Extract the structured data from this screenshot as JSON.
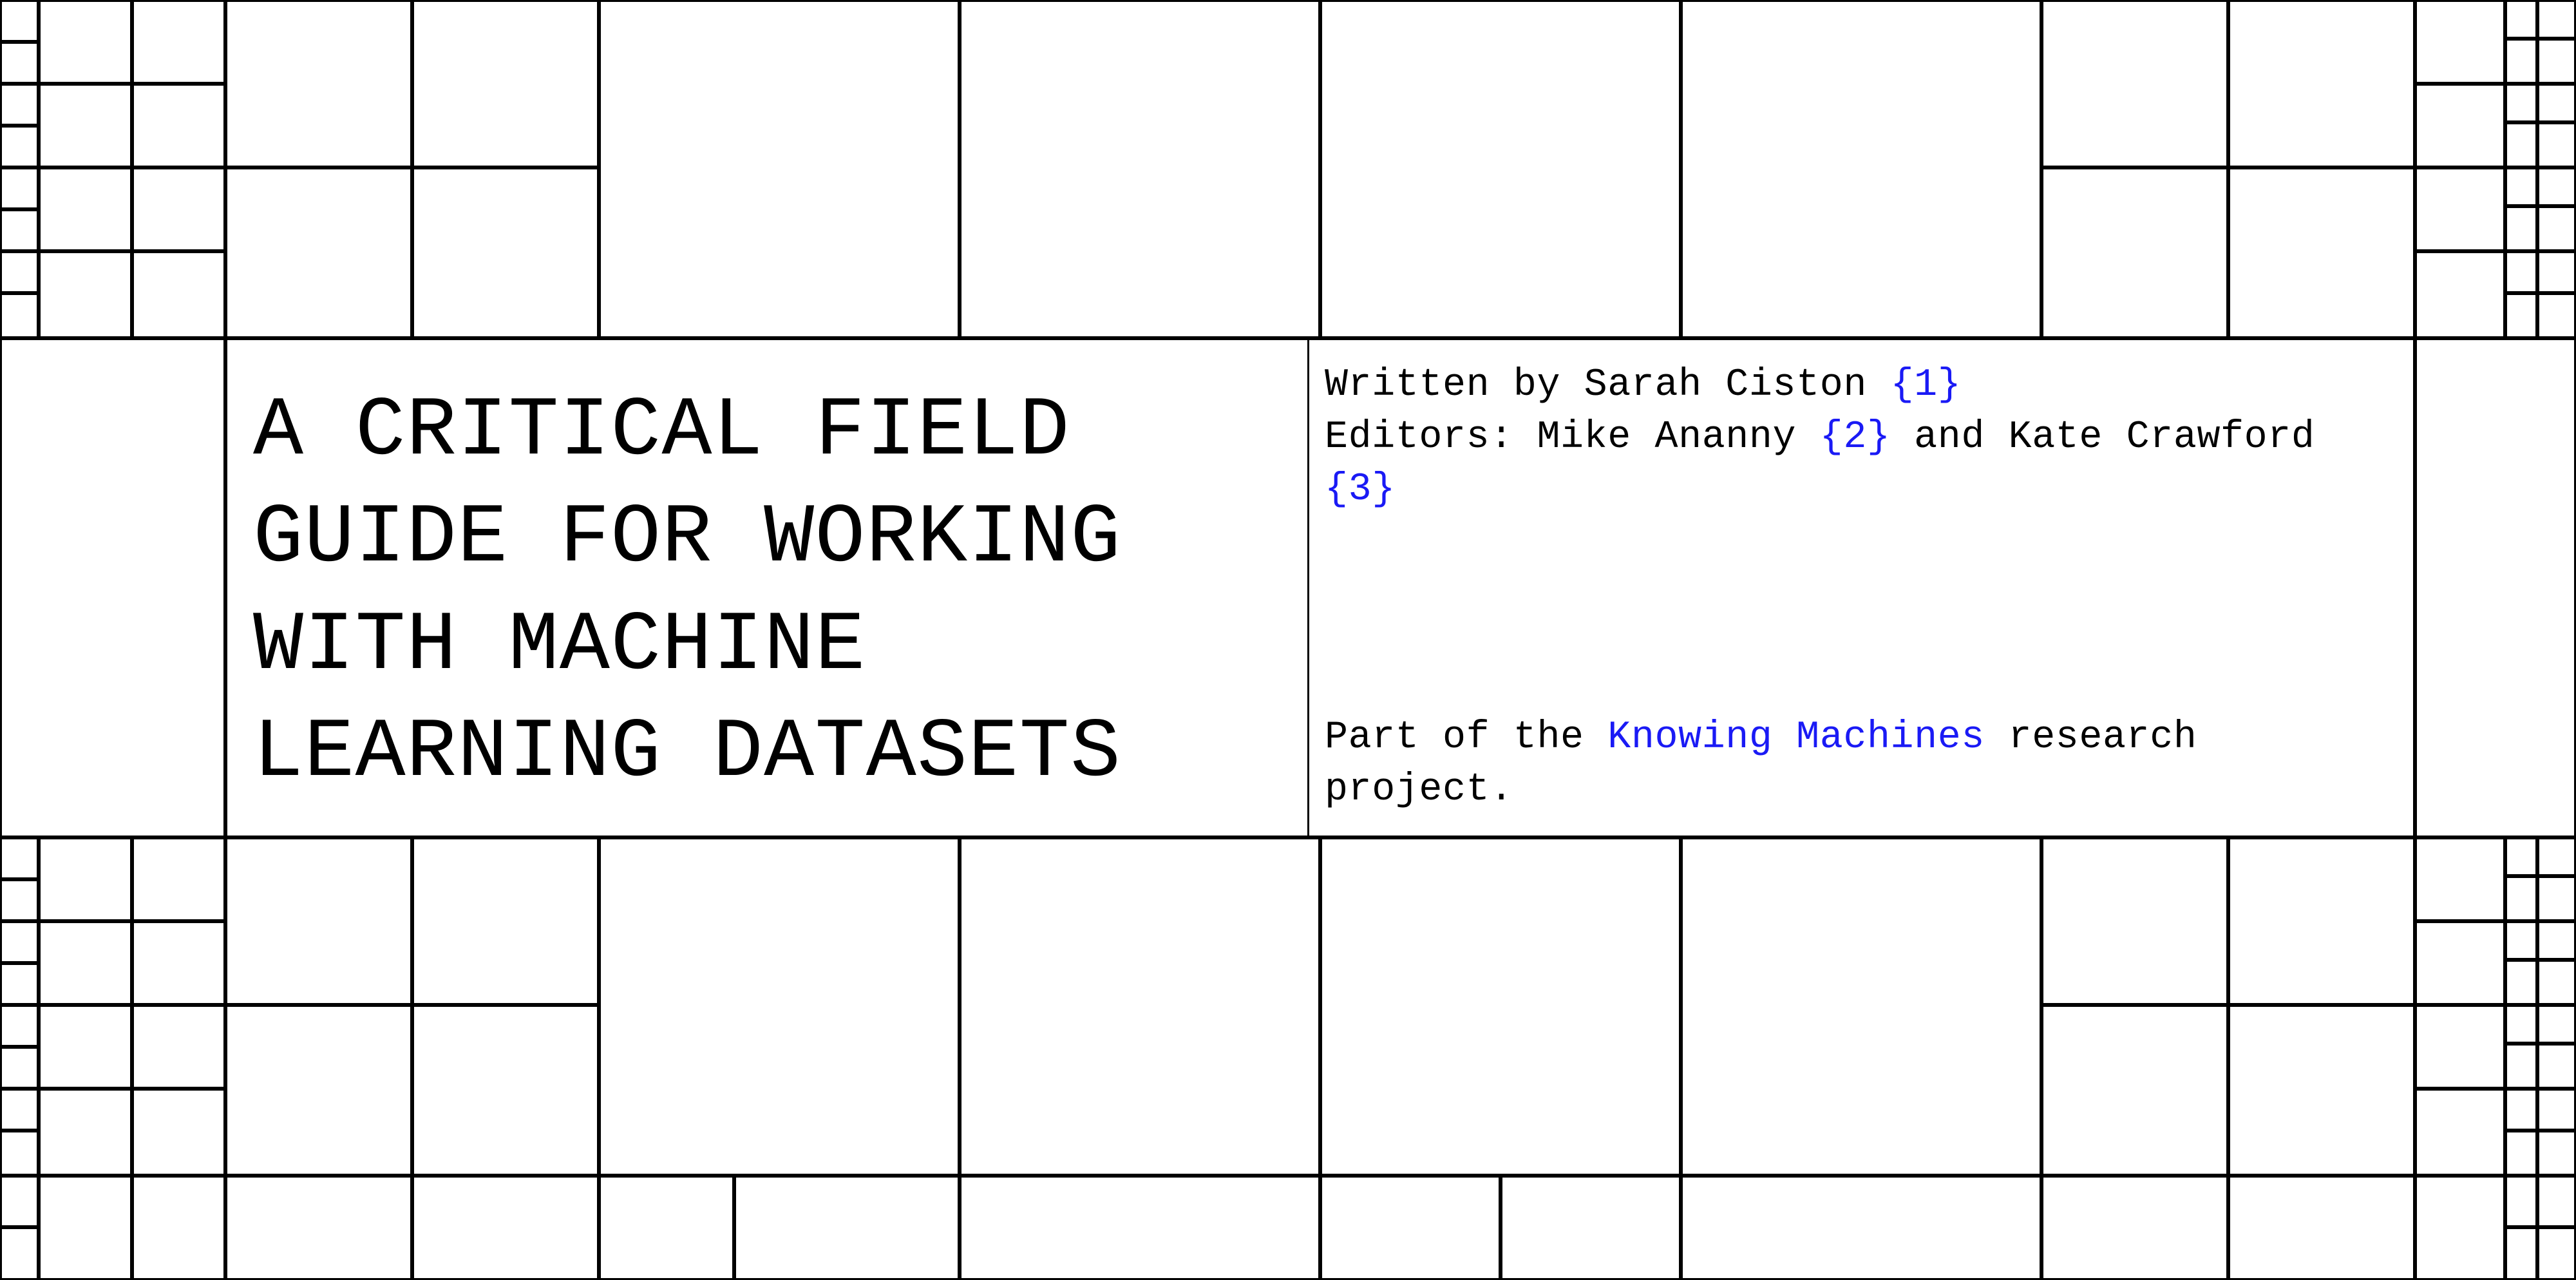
{
  "title": "A CRITICAL FIELD\nGUIDE FOR WORKING\nWITH MACHINE\nLEARNING DATASETS",
  "meta": {
    "written_by_label": "Written by ",
    "author": "Sarah Ciston",
    "ref1": "{1}",
    "editors_label": "Editors: ",
    "editor1": "Mike Ananny",
    "ref2": "{2}",
    "editors_joiner": " and ",
    "editor2": "Kate Crawford",
    "ref3": "{3}",
    "project_prefix": "Part of the ",
    "project_link": "Knowing Machines",
    "project_suffix": " research project."
  }
}
